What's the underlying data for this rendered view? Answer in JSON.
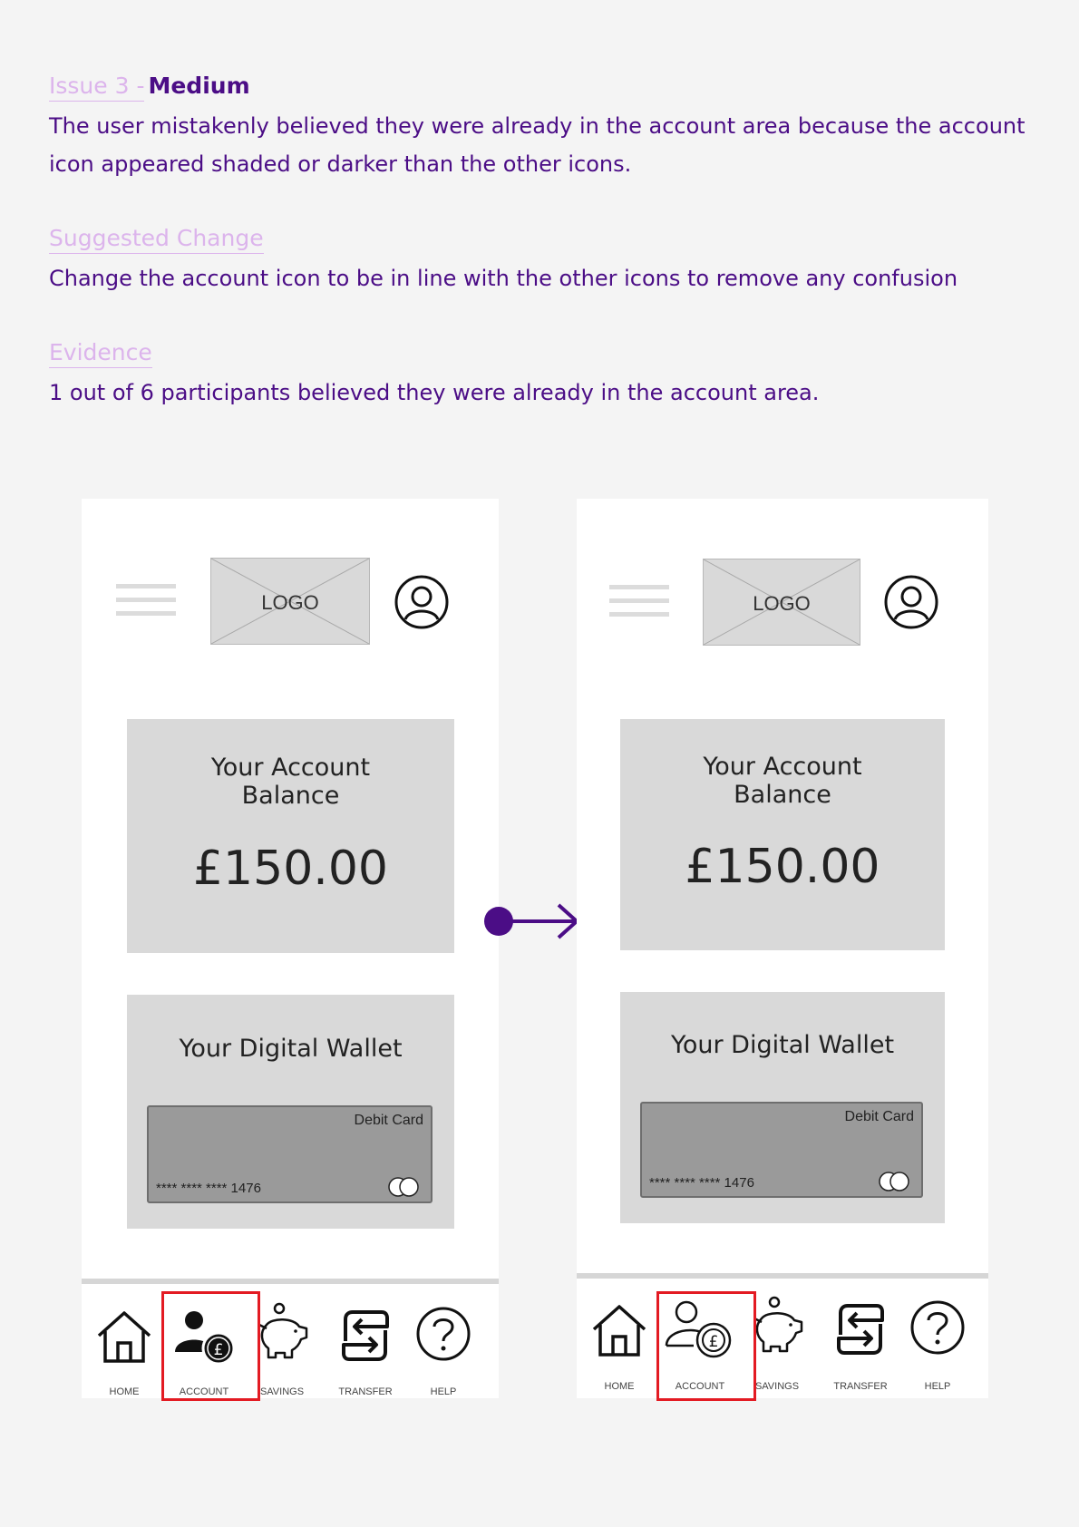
{
  "issue": {
    "label": "Issue 3 -",
    "severity": "Medium",
    "description": "The user mistakenly believed they were already in the account area because the account icon appeared shaded or darker than the other icons."
  },
  "suggested_change": {
    "label": "Suggested Change",
    "text": "Change the account icon to be in line with the other icons to remove any confusion"
  },
  "evidence": {
    "label": "Evidence",
    "text": "1 out of 6 participants believed they were already in the account area."
  },
  "colors": {
    "accent": "#4b0d86",
    "label_lilac": "#dcb4ec",
    "highlight": "#e31b23",
    "background": "#f4f4f4"
  },
  "mockups": {
    "before": {
      "logo": "LOGO",
      "balance_title_line1": "Your Account",
      "balance_title_line2": "Balance",
      "balance_value": "£150.00",
      "wallet_title": "Your Digital Wallet",
      "card_label": "Debit Card",
      "card_number": "**** **** **** 1476",
      "nav": [
        "HOME",
        "ACCOUNT",
        "SAVINGS",
        "TRANSFER",
        "HELP"
      ],
      "account_icon_style": "filled"
    },
    "after": {
      "logo": "LOGO",
      "balance_title_line1": "Your Account",
      "balance_title_line2": "Balance",
      "balance_value": "£150.00",
      "wallet_title": "Your Digital Wallet",
      "card_label": "Debit Card",
      "card_number": "**** **** **** 1476",
      "nav": [
        "HOME",
        "ACCOUNT",
        "SAVINGS",
        "TRANSFER",
        "HELP"
      ],
      "account_icon_style": "outline"
    }
  },
  "icons": {
    "arrow": "arrow-right-icon",
    "menu": "hamburger-menu-icon",
    "profile": "user-circle-icon",
    "home": "home-icon",
    "account": "account-pound-icon",
    "savings": "piggy-bank-icon",
    "transfer": "transfer-arrows-icon",
    "help": "help-question-icon"
  }
}
